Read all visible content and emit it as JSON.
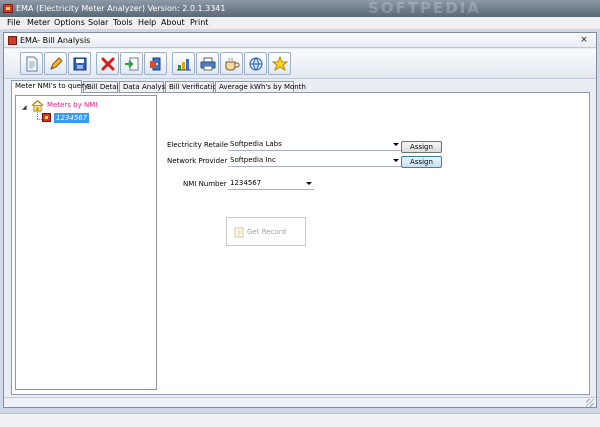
{
  "window": {
    "title": "EMA (Electricity Meter Analyzer) Version: 2.0.1.3341",
    "watermark": "SOFTPEDIA"
  },
  "menu": {
    "items": [
      "File",
      "Meter",
      "Options",
      "Solar",
      "Tools",
      "Help",
      "About",
      "Print"
    ]
  },
  "child_window": {
    "title": "EMA- Bill Analysis",
    "close_glyph": "×"
  },
  "toolbar": {
    "buttons": [
      {
        "icon": "new-document-icon"
      },
      {
        "icon": "pencil-icon"
      },
      {
        "icon": "save-icon"
      },
      {
        "icon": "delete-icon"
      },
      {
        "icon": "import-icon"
      },
      {
        "icon": "export-icon"
      },
      {
        "icon": "bar-chart-icon"
      },
      {
        "icon": "printer-icon"
      },
      {
        "icon": "cup-icon"
      },
      {
        "icon": "network-icon"
      },
      {
        "icon": "star-icon"
      }
    ]
  },
  "tabs": [
    {
      "label": "Meter NMI's to query",
      "active": true
    },
    {
      "label": "Bill Details"
    },
    {
      "label": "Data Analysis"
    },
    {
      "label": "Bill Verification"
    },
    {
      "label": "Average kWh's by Month"
    }
  ],
  "tree": {
    "expander": "◢",
    "root_label": "Meters by NMI",
    "children": [
      {
        "label": "1234567",
        "selected": true
      }
    ]
  },
  "form": {
    "retailer": {
      "label": "Electricity Retailer",
      "value": "Softpedia Labs",
      "button": "Assign"
    },
    "provider": {
      "label": "Network Provider",
      "value": "Softpedia Inc",
      "button": "Assign"
    },
    "nmi": {
      "label": "NMI Number",
      "value": "1234567"
    },
    "get_record": {
      "label": "Get Record",
      "enabled": false
    }
  },
  "colors": {
    "tree_root_label": "#e0207e",
    "selection": "#3399ff",
    "disabled_text": "#a0a0a0"
  }
}
